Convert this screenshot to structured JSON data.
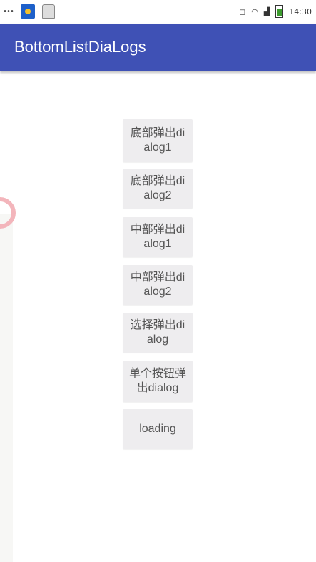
{
  "status_bar": {
    "dots": "⠿⠿⠿",
    "time": "14:30"
  },
  "app_bar": {
    "title": "BottomListDiaLogs"
  },
  "buttons": [
    {
      "label": "底部弹出dialog1"
    },
    {
      "label": "底部弹出dialog2"
    },
    {
      "label": "中部弹出dialog1"
    },
    {
      "label": "中部弹出dialog2"
    },
    {
      "label": "选择弹出dialog"
    },
    {
      "label": "单个按钮弹出dialog"
    },
    {
      "label": "loading"
    }
  ],
  "colors": {
    "app_bar": "#3f51b5",
    "button_bg": "#eeedef",
    "button_text": "#555555"
  }
}
